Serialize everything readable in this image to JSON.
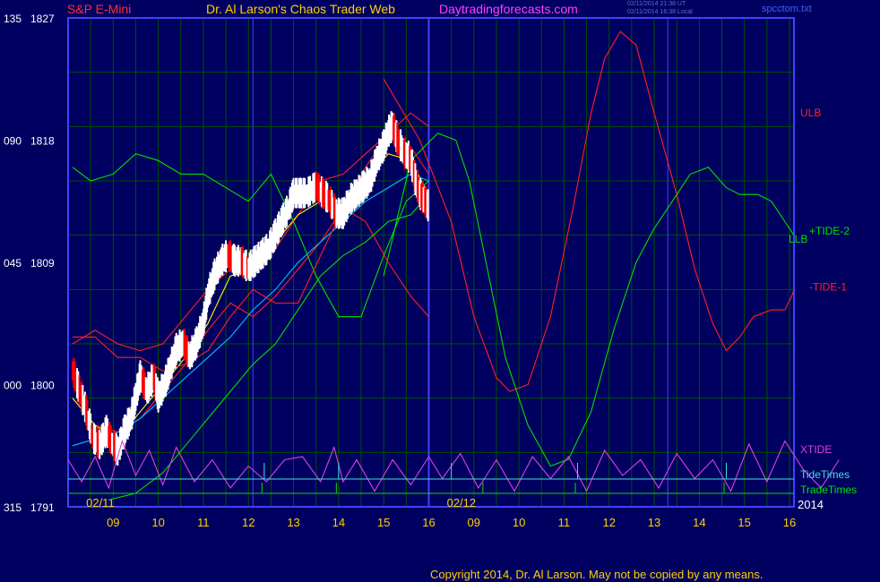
{
  "header": {
    "left_title": "S&P E-Mini",
    "center_title": "Dr. Al Larson's Chaos Trader Web",
    "site": "Daytradingforecasts.com",
    "stamp1": "02/11/2014 21:38 UT",
    "stamp2": "02/11/2014 16:38 Local",
    "file": "spcctom.txt"
  },
  "footer": {
    "copyright": "Copyright 2014, Dr. Al Larson. May not be copied by any means."
  },
  "colors": {
    "background": "#000060",
    "grid": "#005000",
    "border": "#4040ff",
    "price_up": "#ffffff",
    "price_down": "#ff0000",
    "ma_fast": "#ffff00",
    "ma_mid": "#00c0ff",
    "band": "#ff2020",
    "ulb": "#ff2020",
    "llb": "#00e000",
    "tide_plus": "#00e000",
    "tide_minus": "#ff2020",
    "xtide": "#e040e0",
    "tidetimes": "#40e0e0",
    "tradetimes": "#00e000"
  },
  "chart_data": {
    "type": "line",
    "x_date_labels": [
      "02/11",
      "02/12"
    ],
    "x_hour_labels": [
      "09",
      "10",
      "11",
      "12",
      "13",
      "14",
      "15",
      "16",
      "09",
      "10",
      "11",
      "12",
      "13",
      "14",
      "15",
      "16"
    ],
    "year_label": "2014",
    "y_ticks": [
      {
        "left": "135",
        "right": "1827",
        "price": 1827
      },
      {
        "left": "090",
        "right": "1818",
        "price": 1818
      },
      {
        "left": "045",
        "right": "1809",
        "price": 1809
      },
      {
        "left": "000",
        "right": "1800",
        "price": 1800
      },
      {
        "left": "315",
        "right": "1791",
        "price": 1791
      }
    ],
    "ylim": [
      1791,
      1827
    ],
    "xlim": [
      8.0,
      24.1
    ],
    "hour_offset_day2": 8,
    "price": [
      [
        8.1,
        1801.0
      ],
      [
        8.25,
        1799.5
      ],
      [
        8.4,
        1798.0
      ],
      [
        8.55,
        1796.0
      ],
      [
        8.7,
        1795.5
      ],
      [
        8.85,
        1796.5
      ],
      [
        9.0,
        1795.5
      ],
      [
        9.1,
        1795.0
      ],
      [
        9.25,
        1796.5
      ],
      [
        9.4,
        1797.5
      ],
      [
        9.5,
        1799.0
      ],
      [
        9.6,
        1800.5
      ],
      [
        9.75,
        1799.5
      ],
      [
        9.9,
        1800.5
      ],
      [
        10.0,
        1799.0
      ],
      [
        10.15,
        1800.0
      ],
      [
        10.25,
        1801.0
      ],
      [
        10.4,
        1802.5
      ],
      [
        10.55,
        1803.0
      ],
      [
        10.7,
        1802.0
      ],
      [
        10.85,
        1803.0
      ],
      [
        11.0,
        1804.5
      ],
      [
        11.1,
        1806.5
      ],
      [
        11.25,
        1808.0
      ],
      [
        11.4,
        1809.0
      ],
      [
        11.55,
        1809.5
      ],
      [
        11.7,
        1809.0
      ],
      [
        11.85,
        1809.0
      ],
      [
        12.0,
        1808.5
      ],
      [
        12.15,
        1809.0
      ],
      [
        12.3,
        1809.5
      ],
      [
        12.45,
        1810.0
      ],
      [
        12.6,
        1811.0
      ],
      [
        12.75,
        1812.0
      ],
      [
        12.9,
        1813.0
      ],
      [
        13.0,
        1814.0
      ],
      [
        13.15,
        1814.0
      ],
      [
        13.3,
        1814.0
      ],
      [
        13.5,
        1814.5
      ],
      [
        13.65,
        1814.0
      ],
      [
        13.8,
        1813.5
      ],
      [
        13.95,
        1812.5
      ],
      [
        14.1,
        1812.5
      ],
      [
        14.25,
        1813.5
      ],
      [
        14.4,
        1814.0
      ],
      [
        14.55,
        1814.5
      ],
      [
        14.7,
        1815.0
      ],
      [
        14.85,
        1816.5
      ],
      [
        15.0,
        1817.5
      ],
      [
        15.1,
        1818.5
      ],
      [
        15.2,
        1819.0
      ],
      [
        15.3,
        1818.0
      ],
      [
        15.45,
        1817.0
      ],
      [
        15.6,
        1816.5
      ],
      [
        15.7,
        1815.0
      ],
      [
        15.8,
        1814.0
      ],
      [
        15.9,
        1813.5
      ],
      [
        16.0,
        1813.0
      ]
    ],
    "series": [
      {
        "name": "ULB",
        "points": [
          [
            16.0,
            1822.5
          ],
          [
            16.8,
            1818.0
          ],
          [
            17.5,
            1812.0
          ],
          [
            18.0,
            1805.0
          ],
          [
            18.5,
            1800.5
          ],
          [
            18.8,
            1799.5
          ],
          [
            19.2,
            1800.0
          ],
          [
            19.7,
            1805.0
          ],
          [
            20.2,
            1813.0
          ],
          [
            20.6,
            1820.0
          ],
          [
            20.9,
            1824.0
          ],
          [
            21.25,
            1826.0
          ],
          [
            21.6,
            1825.0
          ],
          [
            22.0,
            1820.0
          ],
          [
            22.5,
            1814.0
          ],
          [
            22.9,
            1808.5
          ],
          [
            23.3,
            1804.5
          ],
          [
            23.6,
            1802.5
          ],
          [
            23.9,
            1803.5
          ],
          [
            24.2,
            1805.0
          ],
          [
            24.6,
            1805.5
          ],
          [
            24.9,
            1805.5
          ],
          [
            25.05,
            1806.5
          ],
          [
            25.1,
            1807.0
          ]
        ]
      },
      {
        "name": "LLB",
        "points": [
          [
            16.0,
            1808.0
          ],
          [
            16.6,
            1816.5
          ],
          [
            17.2,
            1818.5
          ],
          [
            17.6,
            1818.0
          ],
          [
            17.9,
            1815.0
          ],
          [
            18.3,
            1808.5
          ],
          [
            18.7,
            1802.0
          ],
          [
            19.2,
            1797.0
          ],
          [
            19.7,
            1794.0
          ],
          [
            20.1,
            1794.5
          ],
          [
            20.6,
            1798.0
          ],
          [
            21.1,
            1804.0
          ],
          [
            21.6,
            1809.0
          ],
          [
            22.0,
            1811.5
          ],
          [
            22.4,
            1813.5
          ],
          [
            22.8,
            1815.5
          ],
          [
            23.2,
            1816.0
          ],
          [
            23.6,
            1814.5
          ],
          [
            23.9,
            1814.0
          ],
          [
            24.3,
            1814.0
          ],
          [
            24.6,
            1813.5
          ],
          [
            24.9,
            1812.0
          ],
          [
            25.1,
            1811.0
          ]
        ]
      },
      {
        "name": "band-upper",
        "points": [
          [
            8.1,
            1803.0
          ],
          [
            8.6,
            1804.0
          ],
          [
            9.1,
            1803.0
          ],
          [
            9.6,
            1802.5
          ],
          [
            10.1,
            1803.0
          ],
          [
            10.6,
            1805.0
          ],
          [
            11.1,
            1807.0
          ],
          [
            11.6,
            1808.5
          ],
          [
            12.1,
            1809.5
          ],
          [
            12.6,
            1810.0
          ],
          [
            13.1,
            1812.5
          ],
          [
            13.6,
            1815.0
          ],
          [
            14.1,
            1815.5
          ],
          [
            14.6,
            1817.0
          ],
          [
            15.1,
            1818.5
          ],
          [
            15.6,
            1820.0
          ],
          [
            16.0,
            1819.0
          ]
        ]
      },
      {
        "name": "band-lower",
        "points": [
          [
            8.1,
            1799.0
          ],
          [
            8.6,
            1797.0
          ],
          [
            9.1,
            1796.5
          ],
          [
            9.6,
            1797.5
          ],
          [
            10.1,
            1799.5
          ],
          [
            10.6,
            1801.5
          ],
          [
            11.1,
            1804.0
          ],
          [
            11.6,
            1806.0
          ],
          [
            12.1,
            1805.0
          ],
          [
            12.6,
            1806.5
          ],
          [
            13.1,
            1808.5
          ],
          [
            13.6,
            1810.5
          ],
          [
            14.1,
            1813.0
          ],
          [
            14.6,
            1812.0
          ],
          [
            15.1,
            1809.0
          ],
          [
            15.6,
            1806.5
          ],
          [
            16.0,
            1805.0
          ]
        ]
      },
      {
        "name": "ma-fast",
        "points": [
          [
            8.1,
            1799.0
          ],
          [
            8.6,
            1797.0
          ],
          [
            9.1,
            1796.0
          ],
          [
            9.6,
            1798.0
          ],
          [
            10.1,
            1800.0
          ],
          [
            10.6,
            1802.0
          ],
          [
            11.1,
            1804.5
          ],
          [
            11.6,
            1808.0
          ],
          [
            12.1,
            1808.5
          ],
          [
            12.6,
            1810.5
          ],
          [
            13.1,
            1812.5
          ],
          [
            13.6,
            1813.5
          ],
          [
            14.1,
            1813.5
          ],
          [
            14.6,
            1815.0
          ],
          [
            15.1,
            1817.0
          ],
          [
            15.6,
            1816.5
          ],
          [
            16.0,
            1814.0
          ]
        ]
      },
      {
        "name": "ma-mid",
        "points": [
          [
            8.1,
            1795.5
          ],
          [
            8.6,
            1796.0
          ],
          [
            9.1,
            1796.5
          ],
          [
            9.6,
            1797.5
          ],
          [
            10.1,
            1799.0
          ],
          [
            10.6,
            1800.5
          ],
          [
            11.1,
            1802.0
          ],
          [
            11.6,
            1803.5
          ],
          [
            12.1,
            1805.5
          ],
          [
            12.6,
            1807.0
          ],
          [
            13.1,
            1809.0
          ],
          [
            13.6,
            1810.5
          ],
          [
            14.1,
            1812.0
          ],
          [
            14.6,
            1813.5
          ],
          [
            15.1,
            1814.5
          ],
          [
            15.6,
            1815.5
          ],
          [
            16.0,
            1815.0
          ]
        ]
      },
      {
        "name": "band-slow",
        "points": [
          [
            8.9,
            1791.5
          ],
          [
            9.5,
            1792.0
          ],
          [
            10.1,
            1793.5
          ],
          [
            10.6,
            1795.5
          ],
          [
            11.1,
            1797.5
          ],
          [
            11.6,
            1799.5
          ],
          [
            12.1,
            1801.5
          ],
          [
            12.6,
            1803.0
          ],
          [
            13.1,
            1805.5
          ],
          [
            13.6,
            1808.0
          ],
          [
            14.1,
            1809.5
          ],
          [
            14.6,
            1810.5
          ],
          [
            15.1,
            1812.0
          ],
          [
            15.6,
            1812.5
          ],
          [
            16.0,
            1814.0
          ]
        ]
      }
    ],
    "tides": [
      {
        "name": "+TIDE-2",
        "points": [
          [
            8.1,
            1816.0
          ],
          [
            8.5,
            1815.0
          ],
          [
            9.0,
            1815.5
          ],
          [
            9.5,
            1817.0
          ],
          [
            10.0,
            1816.5
          ],
          [
            10.5,
            1815.5
          ],
          [
            11.0,
            1815.5
          ],
          [
            11.5,
            1814.5
          ],
          [
            12.0,
            1813.5
          ],
          [
            12.5,
            1815.5
          ],
          [
            13.0,
            1812.0
          ],
          [
            13.5,
            1808.0
          ],
          [
            14.0,
            1805.0
          ],
          [
            14.5,
            1805.0
          ],
          [
            15.0,
            1809.5
          ],
          [
            15.5,
            1813.5
          ],
          [
            16.0,
            1815.0
          ]
        ]
      },
      {
        "name": "-TIDE-1",
        "points": [
          [
            8.1,
            1803.5
          ],
          [
            8.6,
            1803.5
          ],
          [
            9.1,
            1802.0
          ],
          [
            9.6,
            1802.0
          ],
          [
            10.1,
            1801.0
          ],
          [
            10.6,
            1801.5
          ],
          [
            11.1,
            1802.5
          ],
          [
            11.6,
            1805.0
          ],
          [
            12.1,
            1807.0
          ],
          [
            12.6,
            1806.0
          ],
          [
            13.1,
            1806.0
          ],
          [
            13.6,
            1809.5
          ],
          [
            14.1,
            1813.0
          ],
          [
            14.6,
            1816.0
          ],
          [
            15.1,
            1818.5
          ],
          [
            15.6,
            1817.5
          ],
          [
            16.0,
            1815.5
          ]
        ]
      }
    ],
    "right_labels": [
      {
        "text": "ULB",
        "price": 1820.0,
        "color": "#ff2020"
      },
      {
        "text": "+TIDE-2",
        "price": 1811.3,
        "color": "#00e000"
      },
      {
        "text": "LLB",
        "price": 1810.7,
        "color": "#00e000"
      },
      {
        "text": "-TIDE-1",
        "price": 1807.2,
        "color": "#ff2020"
      },
      {
        "text": "XTIDE",
        "price": 1795.3,
        "color": "#e040e0"
      },
      {
        "text": "TideTimes",
        "price": 1793.0,
        "color": "#40e0e0"
      },
      {
        "text": "TradeTimes",
        "price": 1791.9,
        "color": "#00e000"
      }
    ],
    "xtide_wave": [
      [
        8.0,
        0.55
      ],
      [
        8.3,
        0.2
      ],
      [
        8.6,
        0.6
      ],
      [
        8.9,
        0.1
      ],
      [
        9.2,
        0.85
      ],
      [
        9.5,
        0.3
      ],
      [
        9.8,
        0.7
      ],
      [
        10.1,
        0.15
      ],
      [
        10.4,
        0.75
      ],
      [
        10.8,
        0.2
      ],
      [
        11.2,
        0.55
      ],
      [
        11.6,
        0.1
      ],
      [
        12.0,
        0.45
      ],
      [
        12.4,
        0.2
      ],
      [
        12.8,
        0.55
      ],
      [
        13.2,
        0.6
      ],
      [
        13.6,
        0.2
      ],
      [
        13.9,
        0.75
      ],
      [
        14.1,
        0.2
      ],
      [
        14.4,
        0.55
      ],
      [
        14.8,
        0.05
      ],
      [
        15.2,
        0.55
      ],
      [
        15.6,
        0.15
      ],
      [
        16.0,
        0.6
      ],
      [
        16.3,
        0.25
      ],
      [
        16.7,
        0.65
      ],
      [
        17.1,
        0.1
      ],
      [
        17.5,
        0.55
      ],
      [
        17.9,
        0.05
      ],
      [
        18.3,
        0.6
      ],
      [
        18.7,
        0.25
      ],
      [
        19.1,
        0.6
      ],
      [
        19.5,
        0.05
      ],
      [
        19.9,
        0.7
      ],
      [
        20.3,
        0.3
      ],
      [
        20.7,
        0.55
      ],
      [
        21.1,
        0.1
      ],
      [
        21.5,
        0.65
      ],
      [
        21.9,
        0.25
      ],
      [
        22.3,
        0.55
      ],
      [
        22.7,
        0.05
      ],
      [
        23.1,
        0.8
      ],
      [
        23.5,
        0.2
      ],
      [
        23.9,
        0.85
      ],
      [
        24.3,
        0.4
      ],
      [
        24.7,
        0.1
      ],
      [
        25.1,
        0.55
      ]
    ],
    "tide_times": [
      12.35,
      14.0,
      16.5,
      19.3,
      22.6
    ],
    "trade_times": [
      12.3,
      13.95,
      17.2,
      19.25,
      22.55
    ]
  }
}
